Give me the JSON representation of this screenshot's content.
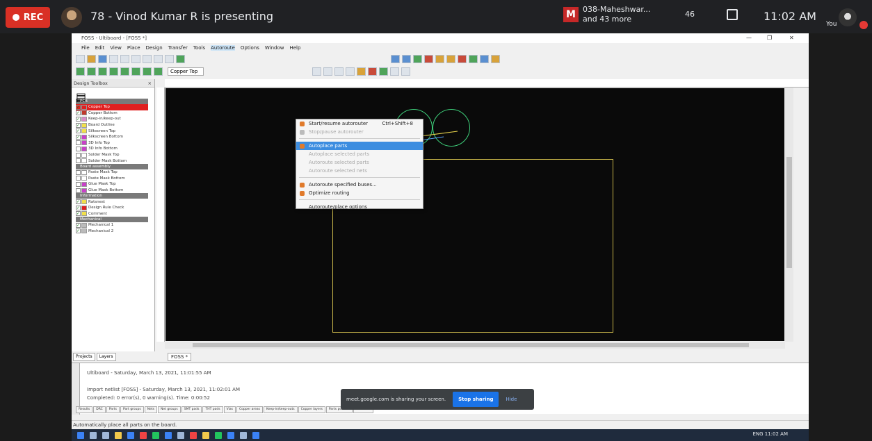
{
  "meet": {
    "rec_label": "REC",
    "presenter_text": "78 - Vinod Kumar R is presenting",
    "participant_badge": "M",
    "participants_line1": "038-Maheshwar...",
    "participants_line2": "and 43 more",
    "people_count": "46",
    "time": "11:02 AM",
    "you_label": "You",
    "share_notice": "meet.google.com is sharing your screen.",
    "stop_sharing_label": "Stop sharing",
    "hide_label": "Hide"
  },
  "app": {
    "title": "FOSS - Ultiboard - [FOSS *]",
    "menu": [
      "File",
      "Edit",
      "View",
      "Place",
      "Design",
      "Transfer",
      "Tools",
      "Autoroute",
      "Options",
      "Window",
      "Help"
    ],
    "active_menu": "Autoroute",
    "layer_select": "Copper Top",
    "toolbox_title": "Design Toolbox",
    "toolbox_close": "×",
    "doc_tab": "FOSS *",
    "status_text": "Automatically place all parts on the board.",
    "left_tabs": [
      "Projects",
      "Layers"
    ]
  },
  "dropdown": {
    "items": [
      {
        "label": "Start/resume autorouter",
        "shortcut": "Ctrl+Shift+8",
        "state": "normal",
        "icon": "autoroute-icon"
      },
      {
        "label": "Stop/pause autorouter",
        "shortcut": "",
        "state": "disabled",
        "icon": "stop-icon"
      },
      {
        "label": "Autoplace parts",
        "shortcut": "",
        "state": "highlighted",
        "icon": "autoplace-icon"
      },
      {
        "label": "Autoplace selected parts",
        "shortcut": "",
        "state": "disabled",
        "icon": ""
      },
      {
        "label": "Autoroute selected parts",
        "shortcut": "",
        "state": "disabled",
        "icon": ""
      },
      {
        "label": "Autoroute selected nets",
        "shortcut": "",
        "state": "disabled",
        "icon": ""
      },
      {
        "label": "Autoroute specified buses...",
        "shortcut": "",
        "state": "normal",
        "icon": "buses-icon"
      },
      {
        "label": "Optimize routing",
        "shortcut": "",
        "state": "normal",
        "icon": "optimize-icon"
      },
      {
        "label": "Autoroute/place options",
        "shortcut": "",
        "state": "normal",
        "icon": ""
      }
    ]
  },
  "layers": {
    "groups": [
      {
        "name": "PCB",
        "rows": [
          {
            "label": "Copper Top",
            "color": "#e02020",
            "checked": true,
            "selected": true
          },
          {
            "label": "Copper Bottom",
            "color": "#c0392b",
            "checked": true,
            "selected": false
          },
          {
            "label": "Keep-in/keep-out",
            "color": "#d98cc8",
            "checked": true,
            "selected": false
          },
          {
            "label": "Board Outline",
            "color": "#f1e04a",
            "checked": true,
            "selected": false
          },
          {
            "label": "Silkscreen Top",
            "color": "#f1e04a",
            "checked": true,
            "selected": false
          },
          {
            "label": "Silkscreen Bottom",
            "color": "#c940c9",
            "checked": true,
            "selected": false
          },
          {
            "label": "3D Info Top",
            "color": "#c940c9",
            "checked": false,
            "selected": false
          },
          {
            "label": "3D Info Bottom",
            "color": "#c940c9",
            "checked": false,
            "selected": false
          },
          {
            "label": "Solder Mask Top",
            "color": "#ffffff",
            "checked": false,
            "selected": false
          },
          {
            "label": "Solder Mask Bottom",
            "color": "#ffffff",
            "checked": false,
            "selected": false
          }
        ]
      },
      {
        "name": "Board assembly",
        "rows": [
          {
            "label": "Paste Mask Top",
            "color": "#ffffff",
            "checked": false,
            "selected": false
          },
          {
            "label": "Paste Mask Bottom",
            "color": "#ffffff",
            "checked": false,
            "selected": false
          },
          {
            "label": "Glue Mask Top",
            "color": "#c940c9",
            "checked": false,
            "selected": false
          },
          {
            "label": "Glue Mask Bottom",
            "color": "#c940c9",
            "checked": false,
            "selected": false
          }
        ]
      },
      {
        "name": "Information",
        "rows": [
          {
            "label": "Ratsnest",
            "color": "#f1e04a",
            "checked": true,
            "selected": false
          },
          {
            "label": "Design Rule Check",
            "color": "#e02020",
            "checked": true,
            "selected": false
          },
          {
            "label": "Comment",
            "color": "#f1e04a",
            "checked": true,
            "selected": false
          }
        ]
      },
      {
        "name": "Mechanical",
        "rows": [
          {
            "label": "Mechanical 1",
            "color": "#bbbbbb",
            "checked": true,
            "selected": false
          },
          {
            "label": "Mechanical 2",
            "color": "#bbbbbb",
            "checked": true,
            "selected": false
          }
        ]
      }
    ]
  },
  "output": {
    "line1": "Ultiboard  -  Saturday, March 13, 2021, 11:01:55 AM",
    "line2": "Import netlist [FOSS]  -  Saturday, March 13, 2021, 11:02:01 AM",
    "line3": "Completed: 0 error(s), 0 warning(s). Time: 0:00:52",
    "side_label": "Spreadsheet View",
    "tabs": [
      "Results",
      "DRC",
      "Parts",
      "Part groups",
      "Nets",
      "Net groups",
      "SMT pads",
      "THT pads",
      "Vias",
      "Copper areas",
      "Keep-in/keep-outs",
      "Copper layers",
      "Parts position",
      "Statistics"
    ]
  },
  "tray": {
    "text": "ENG   11:02 AM"
  }
}
